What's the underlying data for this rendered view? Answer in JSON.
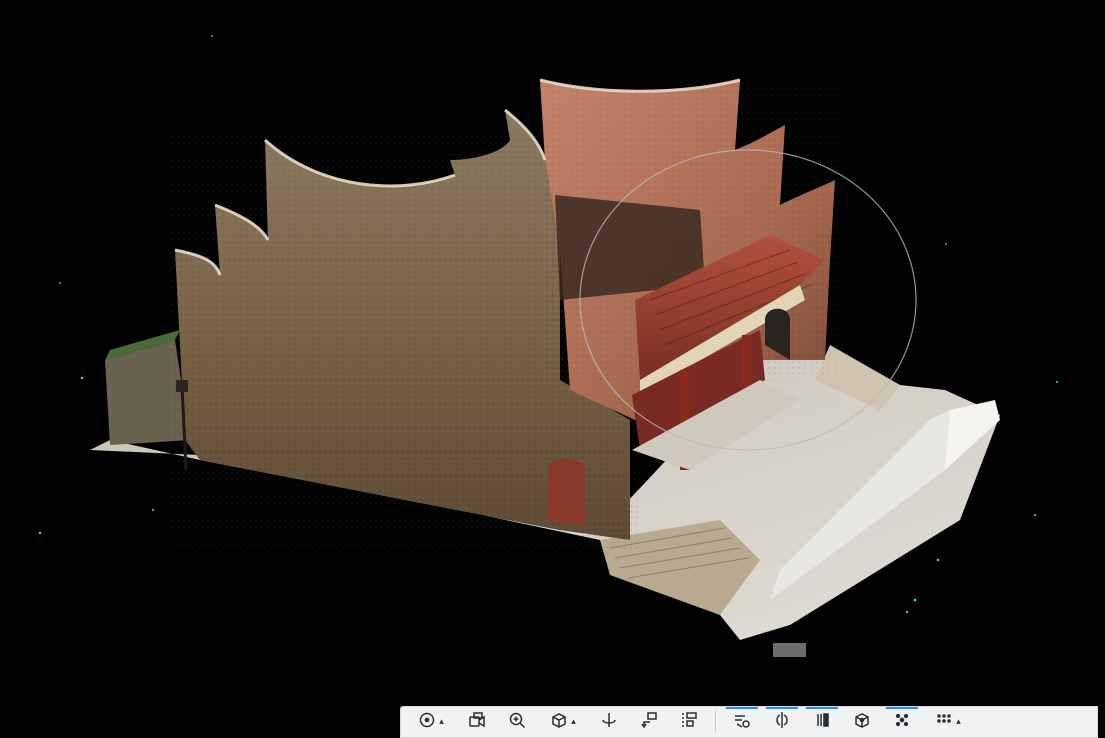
{
  "viewer": {
    "background_color": "#020202",
    "scene": "point-cloud-ancient-building"
  },
  "toolbar": {
    "accent_color": "#1f8ef1",
    "buttons": [
      {
        "id": "target",
        "icon": "target-icon",
        "dropdown": true,
        "active": false
      },
      {
        "id": "camera",
        "icon": "camera-icon",
        "dropdown": false,
        "active": false
      },
      {
        "id": "zoom",
        "icon": "zoom-icon",
        "dropdown": false,
        "active": false
      },
      {
        "id": "cube-view",
        "icon": "cube-view-icon",
        "dropdown": true,
        "active": false
      },
      {
        "id": "rotate-axis",
        "icon": "rotate-axis-icon",
        "dropdown": false,
        "active": false
      },
      {
        "id": "flip",
        "icon": "flip-icon",
        "dropdown": false,
        "active": false
      },
      {
        "id": "align",
        "icon": "align-icon",
        "dropdown": false,
        "active": false
      },
      {
        "id": "clip-tool",
        "icon": "clip-tool-icon",
        "dropdown": false,
        "active": true
      },
      {
        "id": "split",
        "icon": "split-icon",
        "dropdown": false,
        "active": true
      },
      {
        "id": "section",
        "icon": "section-icon",
        "dropdown": false,
        "active": true
      },
      {
        "id": "box",
        "icon": "box-icon",
        "dropdown": false,
        "active": false
      },
      {
        "id": "points",
        "icon": "points-icon",
        "dropdown": false,
        "active": true
      },
      {
        "id": "grid-more",
        "icon": "grid-more-icon",
        "dropdown": true,
        "active": false
      }
    ]
  }
}
